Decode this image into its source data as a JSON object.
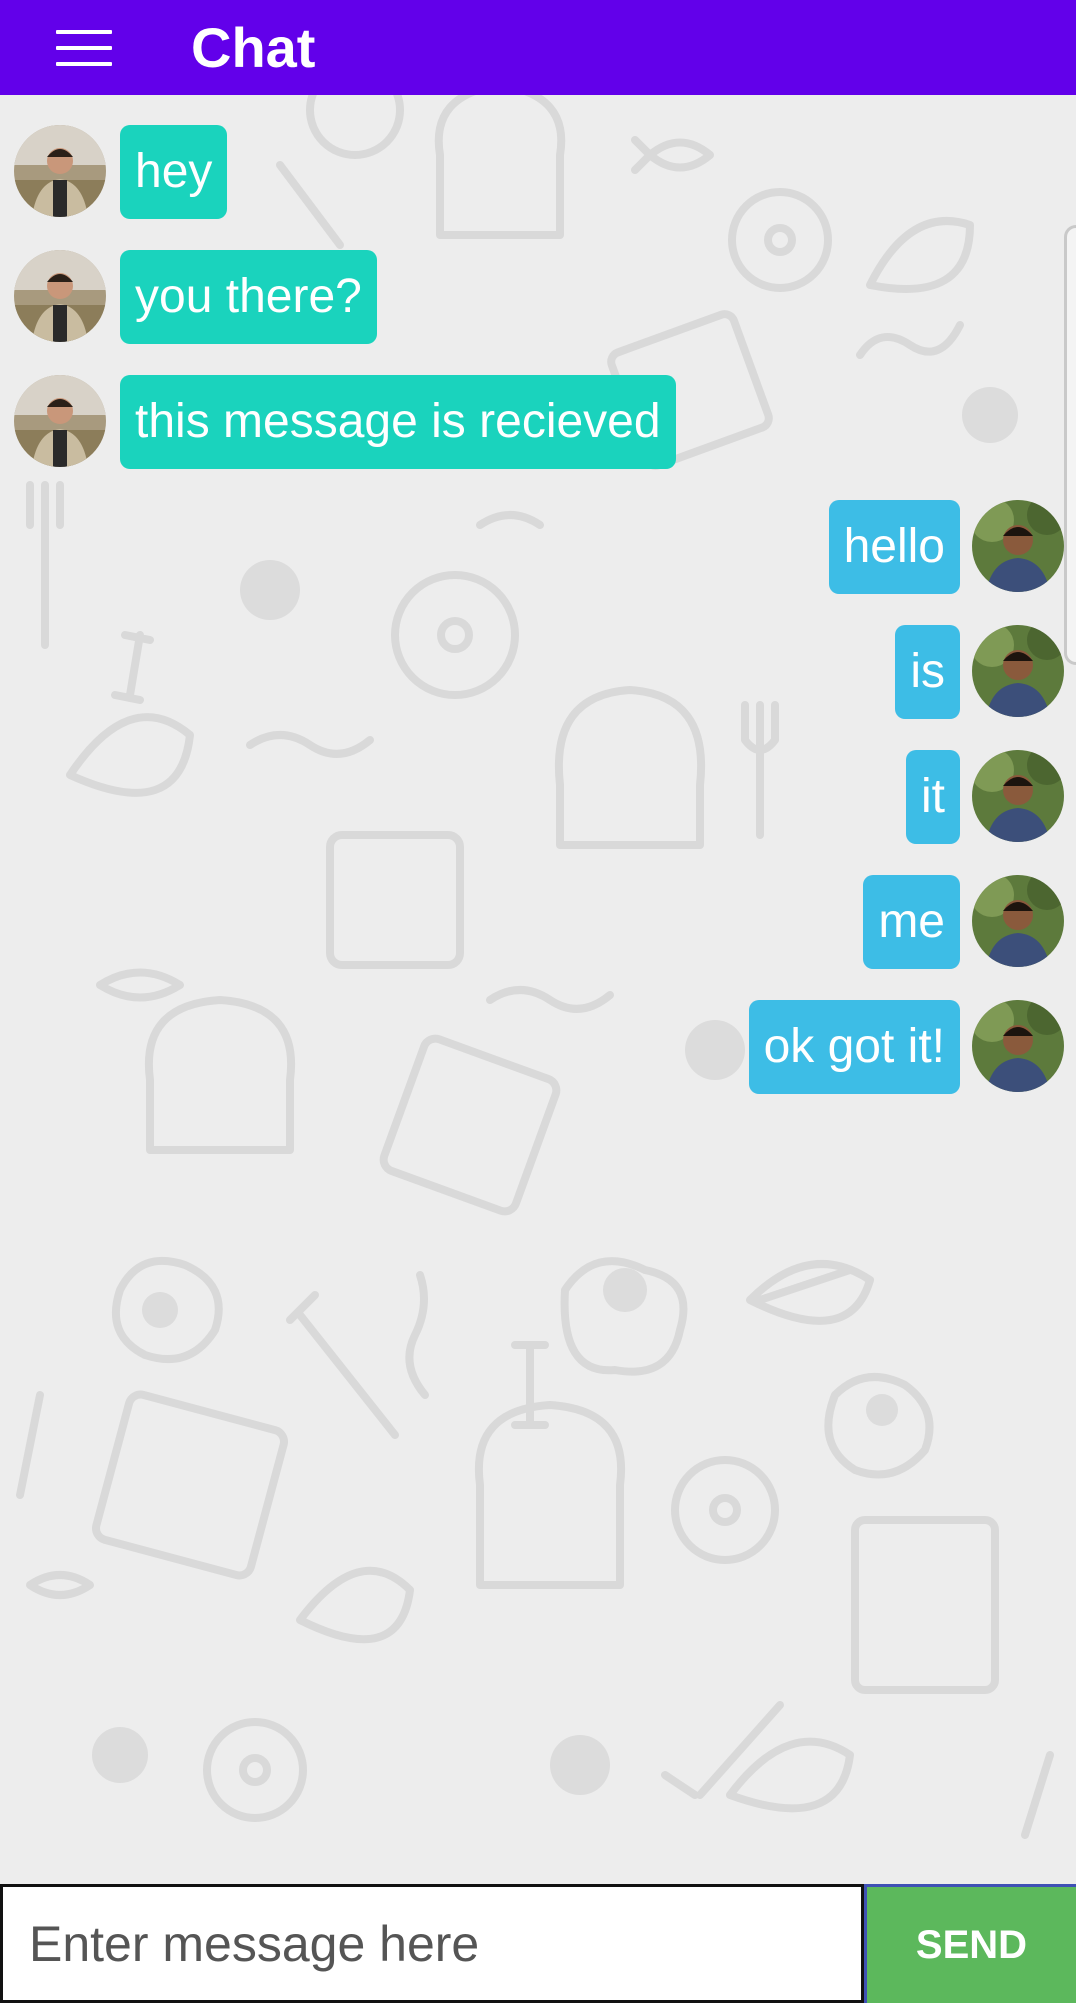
{
  "app_bar": {
    "menu_icon": "hamburger-menu-icon",
    "title": "Chat",
    "color": "#6200ea"
  },
  "messages": [
    {
      "direction": "incoming",
      "text": "hey",
      "avatar": "sender-avatar"
    },
    {
      "direction": "incoming",
      "text": "you there?",
      "avatar": "sender-avatar"
    },
    {
      "direction": "incoming",
      "text": "this message is recieved",
      "avatar": "sender-avatar"
    },
    {
      "direction": "outgoing",
      "text": "hello",
      "avatar": "user-avatar"
    },
    {
      "direction": "outgoing",
      "text": "is",
      "avatar": "user-avatar"
    },
    {
      "direction": "outgoing",
      "text": "it",
      "avatar": "user-avatar"
    },
    {
      "direction": "outgoing",
      "text": "me",
      "avatar": "user-avatar"
    },
    {
      "direction": "outgoing",
      "text": "ok got it!",
      "avatar": "user-avatar"
    }
  ],
  "colors": {
    "incoming_bubble": "#1ad3bd",
    "outgoing_bubble": "#3dbde6",
    "send_button": "#5cb85c"
  },
  "composer": {
    "placeholder": "Enter message here",
    "value": "",
    "send_label": "SEND"
  }
}
